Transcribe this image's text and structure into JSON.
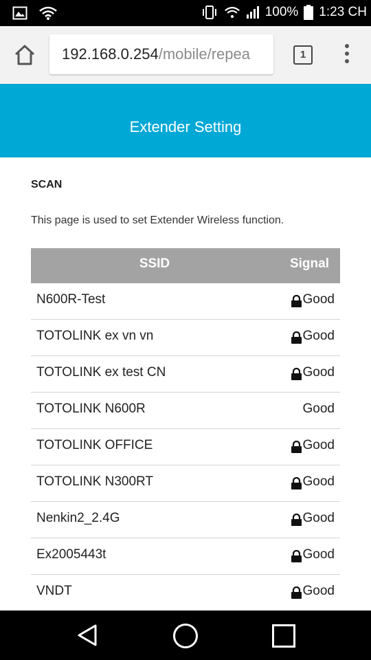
{
  "status_bar": {
    "battery": "100%",
    "time": "1:23 CH",
    "icons": [
      "image-icon",
      "wifi-icon",
      "vibrate-icon",
      "wifi-icon",
      "signal-icon",
      "battery-icon"
    ]
  },
  "browser": {
    "url_host": "192.168.0.254",
    "url_path": "/mobile/repea",
    "tab_count": "1",
    "icons": [
      "home-icon",
      "tabs-icon",
      "overflow-menu-icon"
    ]
  },
  "page": {
    "header_title": "Extender Setting",
    "section_title": "SCAN",
    "description": "This page is used to set Extender Wireless function."
  },
  "table": {
    "headers": {
      "ssid": "SSID",
      "signal": "Signal"
    },
    "rows": [
      {
        "ssid": "N600R-Test",
        "signal": "Good",
        "locked": true
      },
      {
        "ssid": "TOTOLINK ex vn vn",
        "signal": "Good",
        "locked": true
      },
      {
        "ssid": "TOTOLINK ex test CN",
        "signal": "Good",
        "locked": true
      },
      {
        "ssid": "TOTOLINK N600R",
        "signal": "Good",
        "locked": false
      },
      {
        "ssid": "TOTOLINK OFFICE",
        "signal": "Good",
        "locked": true
      },
      {
        "ssid": "TOTOLINK N300RT",
        "signal": "Good",
        "locked": true
      },
      {
        "ssid": "Nenkin2_2.4G",
        "signal": "Good",
        "locked": true
      },
      {
        "ssid": "Ex2005443t",
        "signal": "Good",
        "locked": true
      },
      {
        "ssid": "VNDT",
        "signal": "Good",
        "locked": true
      }
    ]
  },
  "colors": {
    "header_bg": "#00a8d6",
    "table_header_bg": "#a3a3a3"
  }
}
